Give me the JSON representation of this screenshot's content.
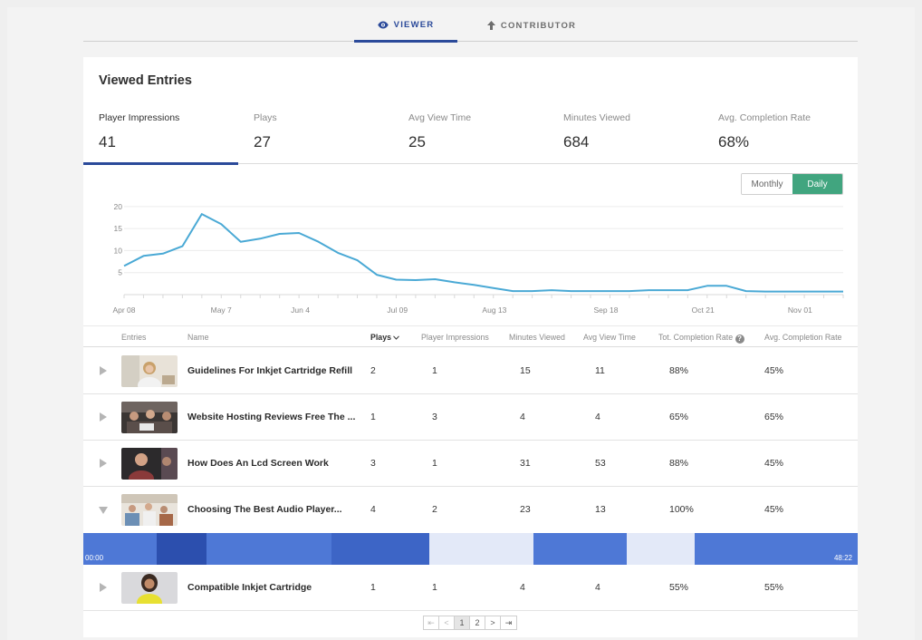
{
  "tabs": {
    "viewer": "VIEWER",
    "contributor": "CONTRIBUTOR"
  },
  "title": "Viewed Entries",
  "kpis": [
    {
      "label": "Player Impressions",
      "value": "41"
    },
    {
      "label": "Plays",
      "value": "27"
    },
    {
      "label": "Avg View Time",
      "value": "25"
    },
    {
      "label": "Minutes Viewed",
      "value": "684"
    },
    {
      "label": "Avg. Completion Rate",
      "value": "68%"
    }
  ],
  "toggle": {
    "monthly": "Monthly",
    "daily": "Daily",
    "selected": "Daily"
  },
  "colors": {
    "accent": "#2b4a9a",
    "line": "#4aa9d5",
    "daily_bg": "#41a57f",
    "timeline": "#4e78d6"
  },
  "chart_data": {
    "type": "line",
    "x_ticks": [
      "Apr 08",
      "May 7",
      "Jun 4",
      "Jul 09",
      "Aug 13",
      "Sep 18",
      "Oct 21",
      "Nov 01"
    ],
    "y_ticks": [
      5,
      10,
      15,
      20
    ],
    "ylim": [
      0,
      21
    ],
    "values": [
      6.5,
      8.8,
      9.3,
      11,
      18.3,
      16,
      12,
      12.7,
      13.8,
      14,
      12,
      9.5,
      7.8,
      4.5,
      3.4,
      3.3,
      3.5,
      2.8,
      2.2,
      1.5,
      0.8,
      0.8,
      1,
      0.8,
      0.8,
      0.8,
      0.8,
      1,
      1,
      1,
      2,
      2,
      0.8,
      0.7,
      0.7,
      0.7,
      0.7,
      0.7
    ],
    "grid": true
  },
  "table": {
    "headers": {
      "entries": "Entries",
      "name": "Name",
      "plays": "Plays",
      "impressions": "Player Impressions",
      "minutes": "Minutes Viewed",
      "avg_view": "Avg View Time",
      "tot_completion": "Tot. Completion Rate",
      "avg_completion": "Avg. Completion Rate"
    },
    "rows": [
      {
        "name": "Guidelines For Inkjet Cartridge Refill",
        "plays": "2",
        "impressions": "1",
        "minutes": "15",
        "avg_view": "11",
        "tot": "88%",
        "avg": "45%",
        "expanded": false
      },
      {
        "name": "Website Hosting Reviews Free The ...",
        "plays": "1",
        "impressions": "3",
        "minutes": "4",
        "avg_view": "4",
        "tot": "65%",
        "avg": "65%",
        "expanded": false
      },
      {
        "name": "How Does An Lcd Screen Work",
        "plays": "3",
        "impressions": "1",
        "minutes": "31",
        "avg_view": "53",
        "tot": "88%",
        "avg": "45%",
        "expanded": false
      },
      {
        "name": "Choosing The Best Audio Player...",
        "plays": "4",
        "impressions": "2",
        "minutes": "23",
        "avg_view": "13",
        "tot": "100%",
        "avg": "45%",
        "expanded": true
      },
      {
        "name": "Compatible Inkjet Cartridge",
        "plays": "1",
        "impressions": "1",
        "minutes": "4",
        "avg_view": "4",
        "tot": "55%",
        "avg": "55%",
        "expanded": false
      }
    ]
  },
  "timeline": {
    "start": "00:00",
    "end": "48:22",
    "segments": [
      {
        "color": "#4e78d6",
        "from": 0,
        "to": 0.095
      },
      {
        "color": "#2c4fae",
        "from": 0.095,
        "to": 0.159
      },
      {
        "color": "#4e78d6",
        "from": 0.159,
        "to": 0.321
      },
      {
        "color": "#3d65c6",
        "from": 0.321,
        "to": 0.447
      },
      {
        "color": "#e3e9f8",
        "from": 0.447,
        "to": 0.581
      },
      {
        "color": "#4e78d6",
        "from": 0.581,
        "to": 0.702
      },
      {
        "color": "#e3e9f8",
        "from": 0.702,
        "to": 0.789
      },
      {
        "color": "#4e78d6",
        "from": 0.789,
        "to": 1
      }
    ]
  },
  "pager": {
    "first": "⇤",
    "prev": "<",
    "p1": "1",
    "p2": "2",
    "next": ">",
    "last": "⇥",
    "current": "1"
  }
}
